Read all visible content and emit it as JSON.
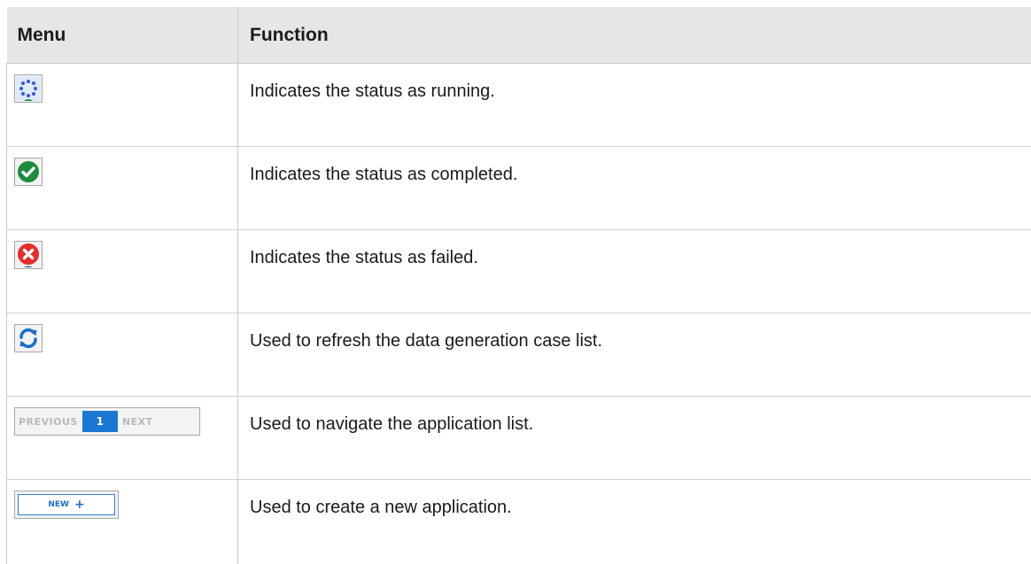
{
  "table": {
    "headers": {
      "menu": "Menu",
      "function": "Function"
    },
    "rows": [
      {
        "icon": "loading-spinner-icon",
        "function": "Indicates the status as running."
      },
      {
        "icon": "check-circle-icon",
        "function": "Indicates the status as completed."
      },
      {
        "icon": "error-x-circle-icon",
        "function": "Indicates the status as failed."
      },
      {
        "icon": "refresh-icon",
        "function": "Used to refresh the data generation case list."
      },
      {
        "icon": "pagination-control",
        "function": "Used to navigate the application list.",
        "pager": {
          "previous": "PREVIOUS",
          "page": "1",
          "next": "NEXT"
        }
      },
      {
        "icon": "new-button",
        "function": "Used to create a new application.",
        "new_button": {
          "label": "NEW",
          "symbol": "+"
        }
      }
    ]
  },
  "colors": {
    "header_bg": "#e6e6e6",
    "success": "#1e8a3c",
    "error": "#e52b2b",
    "accent": "#1a78d2"
  }
}
